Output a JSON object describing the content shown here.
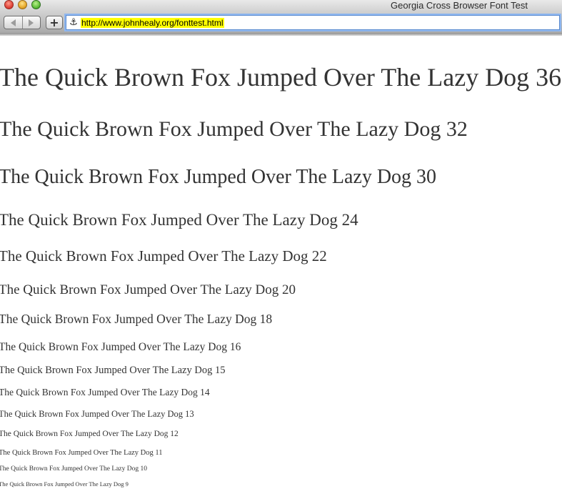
{
  "window": {
    "title": "Georgia Cross Browser Font Test"
  },
  "toolbar": {
    "back_icon": "back-arrow-icon",
    "forward_icon": "forward-arrow-icon",
    "add_label": "+",
    "address_icon": "anchor-icon",
    "address_glyph": "⚓",
    "url": "http://www.johnhealy.org/fonttest.html",
    "url_highlight_color": "#ffff00",
    "focus_ring_color": "#8fb7ef"
  },
  "samples": [
    {
      "size": 36,
      "text": "The Quick Brown Fox Jumped Over The Lazy Dog 36"
    },
    {
      "size": 32,
      "text": "The Quick Brown Fox Jumped Over The Lazy Dog 32"
    },
    {
      "size": 30,
      "text": "The Quick Brown Fox Jumped Over The Lazy Dog 30"
    },
    {
      "size": 24,
      "text": "The Quick Brown Fox Jumped Over The Lazy Dog 24"
    },
    {
      "size": 22,
      "text": "The Quick Brown Fox Jumped Over The Lazy Dog 22"
    },
    {
      "size": 20,
      "text": "The Quick Brown Fox Jumped Over The Lazy Dog 20"
    },
    {
      "size": 18,
      "text": "The Quick Brown Fox Jumped Over The Lazy Dog 18"
    },
    {
      "size": 16,
      "text": "The Quick Brown Fox Jumped Over The Lazy Dog 16"
    },
    {
      "size": 15,
      "text": "The Quick Brown Fox Jumped Over The Lazy Dog 15"
    },
    {
      "size": 14,
      "text": "The Quick Brown Fox Jumped Over The Lazy Dog 14"
    },
    {
      "size": 13,
      "text": "The Quick Brown Fox Jumped Over The Lazy Dog 13"
    },
    {
      "size": 12,
      "text": "The Quick Brown Fox Jumped Over The Lazy Dog 12"
    },
    {
      "size": 11,
      "text": "The Quick Brown Fox Jumped Over The Lazy Dog 11"
    },
    {
      "size": 10,
      "text": "The Quick Brown Fox Jumped Over The Lazy Dog 10"
    },
    {
      "size": 9,
      "text": "The Quick Brown Fox Jumped Over The Lazy Dog 9"
    }
  ]
}
